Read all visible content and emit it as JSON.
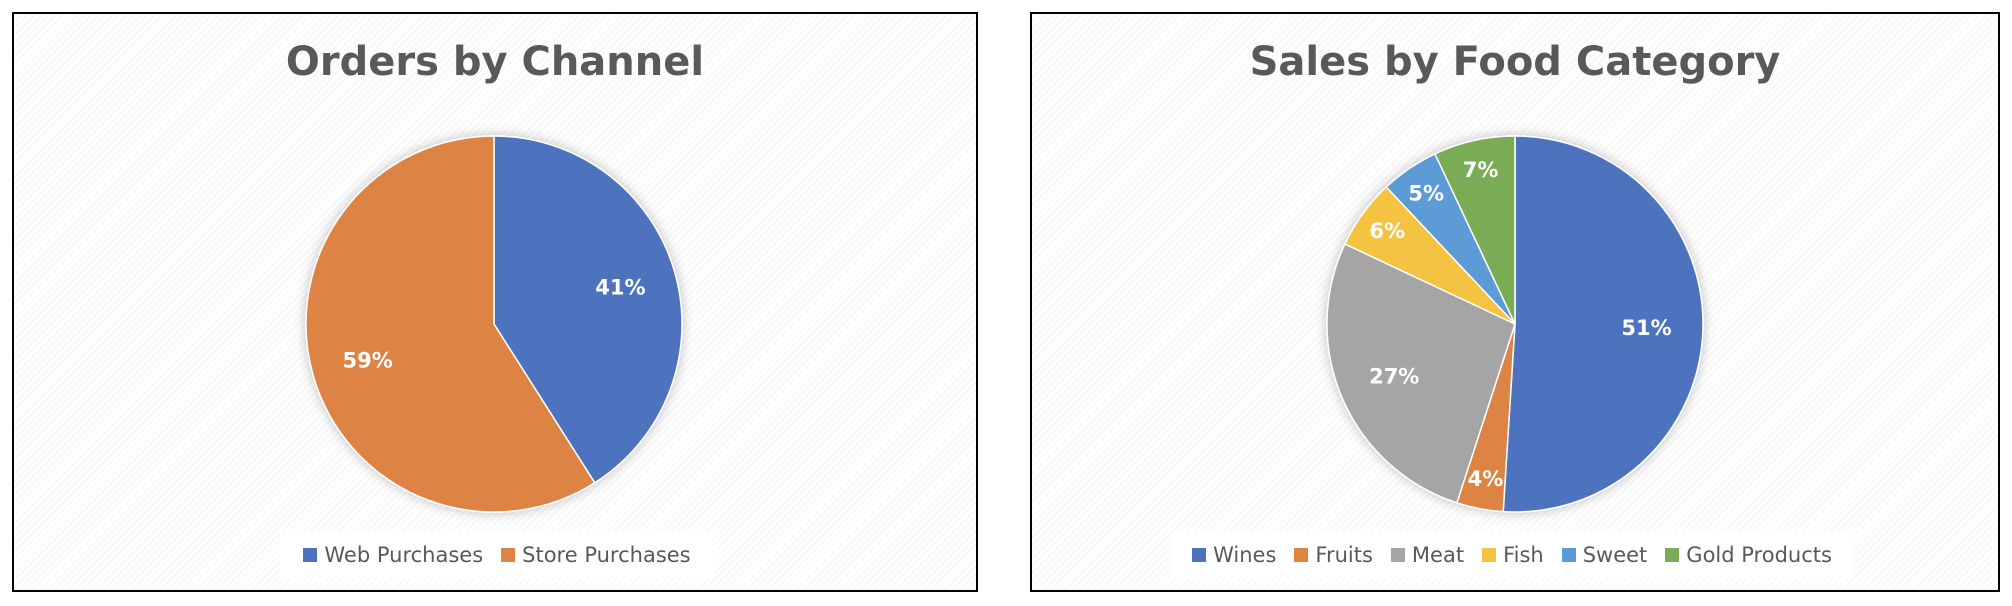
{
  "chart_data": [
    {
      "type": "pie",
      "title": "Orders by Channel",
      "categories": [
        "Web Purchases",
        "Store Purchases"
      ],
      "values": [
        41,
        59
      ],
      "labels": [
        "41%",
        "59%"
      ],
      "colors": [
        "#4E72BE",
        "#DD8444"
      ],
      "legend_position": "bottom",
      "start_angle": "12 o'clock",
      "direction": "clockwise"
    },
    {
      "type": "pie",
      "title": "Sales by Food Category",
      "categories": [
        "Wines",
        "Fruits",
        "Meat",
        "Fish",
        "Sweet",
        "Gold Products"
      ],
      "values": [
        51,
        4,
        27,
        6,
        5,
        7
      ],
      "labels": [
        "51%",
        "4%",
        "27%",
        "6%",
        "5%",
        "7%"
      ],
      "colors": [
        "#4E72BE",
        "#DD8444",
        "#A5A5A5",
        "#F5C342",
        "#5B9BD5",
        "#7AAB55"
      ],
      "legend_position": "bottom",
      "start_angle": "12 o'clock",
      "direction": "clockwise"
    }
  ]
}
